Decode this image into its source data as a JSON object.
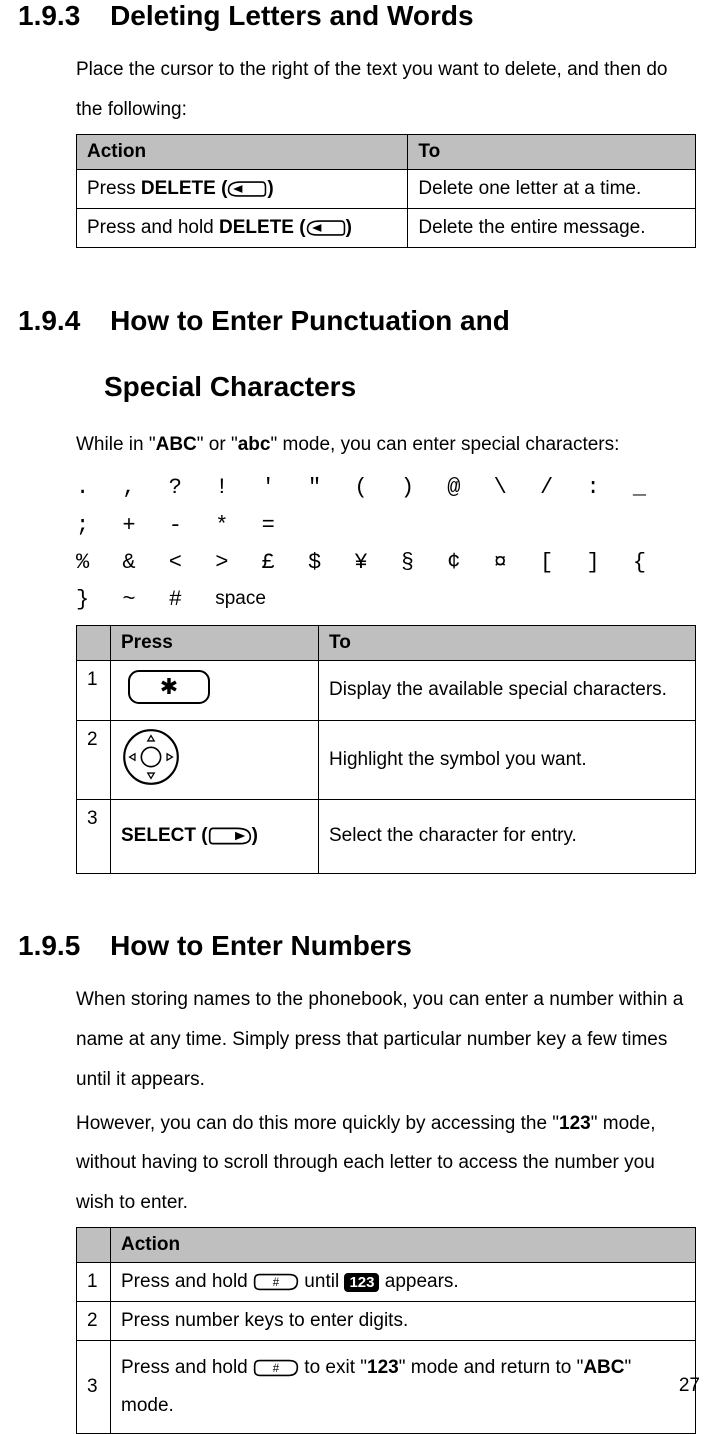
{
  "s193": {
    "number": "1.9.3",
    "title": "Deleting Letters and Words",
    "intro": "Place the cursor to the right of the text you want to delete, and then do the following:",
    "table": {
      "h1": "Action",
      "h2": "To",
      "r1a_pre": "Press ",
      "r1a_b": "DELETE (",
      "r1a_post": ")",
      "r1b": "Delete one letter at a time.",
      "r2a_pre": "Press and hold ",
      "r2a_b": "DELETE (",
      "r2a_post": ")",
      "r2b": "Delete the entire message."
    }
  },
  "s194": {
    "number": "1.9.4",
    "title_l1": "How to Enter Punctuation and",
    "title_l2": "Special Characters",
    "intro_pre": "While in \"",
    "intro_b1": "ABC",
    "intro_mid": "\" or \"",
    "intro_b2": "abc",
    "intro_post": "\" mode, you can enter special characters:",
    "symbols_l1": ". , ? ! ' \" ( ) @ \\ / : _ ; + - * =",
    "symbols_l2": "% & < > £ $ ¥ § ¢ ¤ [ ] { } ~ # ",
    "space_word": "space",
    "table": {
      "h1": "Press",
      "h2": "To",
      "n1": "1",
      "r1b": "Display the available special characters.",
      "n2": "2",
      "r2b": "Highlight the symbol you want.",
      "n3": "3",
      "r3a_b": "SELECT (",
      "r3a_post": ")",
      "r3b": "Select the character for entry."
    }
  },
  "s195": {
    "number": "1.9.5",
    "title": "How to Enter Numbers",
    "p1_pre": "When storing names to the phonebook, you can enter a number within a name at any time. Simply press that particular number key a few times until it appears.",
    "p2_pre": "However, you can do this more quickly by accessing the \"",
    "p2_b": "123",
    "p2_post": "\" mode, without having to scroll through each letter to access the number you wish to enter.",
    "table": {
      "h1": "Action",
      "n1": "1",
      "r1_pre": "Press and hold ",
      "r1_mid": " until ",
      "badge": "123",
      "r1_post": " appears.",
      "n2": "2",
      "r2": "Press number keys to enter digits.",
      "n3": "3",
      "r3_pre": "Press and hold ",
      "r3_mid": " to exit \"",
      "r3_b": "123",
      "r3_mid2": "\" mode and return to \"",
      "r3_b2": "ABC",
      "r3_post": "\" mode."
    }
  },
  "page_number": "27"
}
